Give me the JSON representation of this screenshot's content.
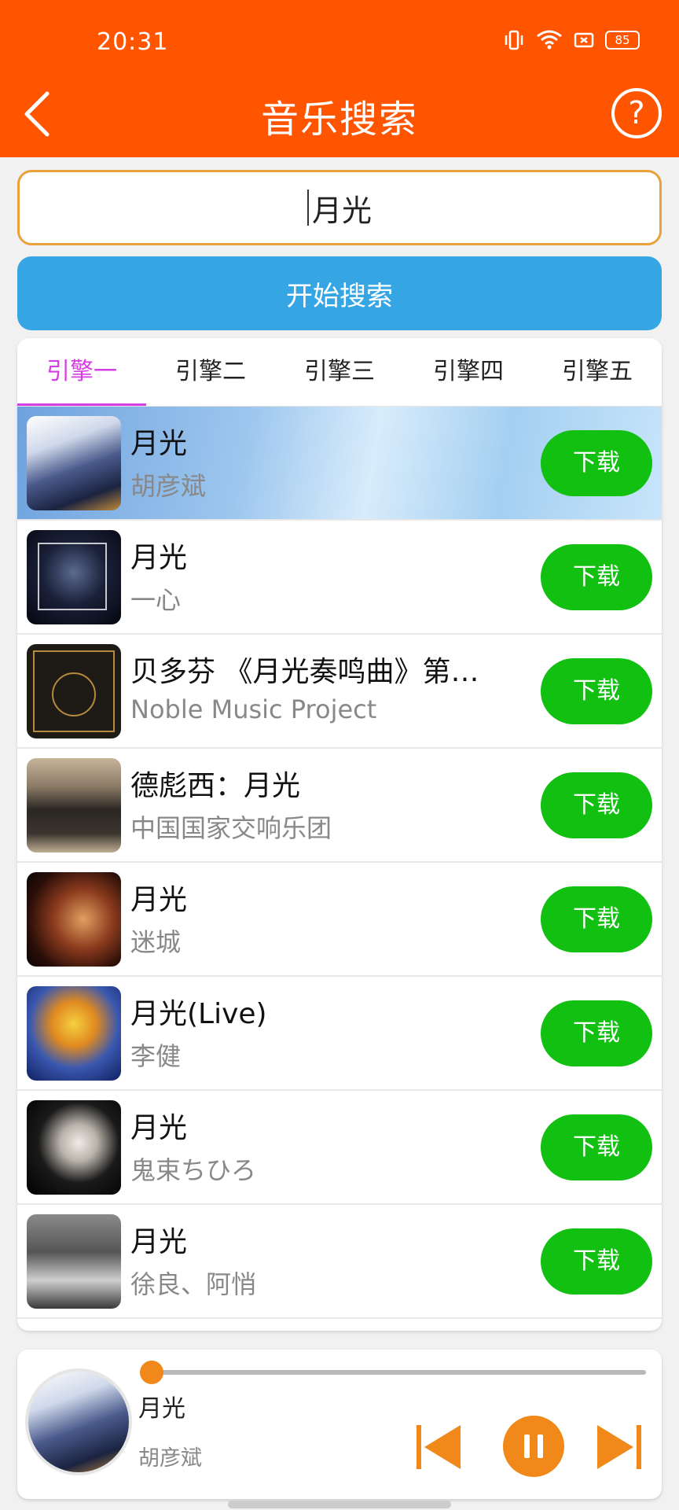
{
  "status": {
    "time": "20:31",
    "battery": "85"
  },
  "header": {
    "title": "音乐搜索"
  },
  "search": {
    "value": "月光",
    "button_label": "开始搜索"
  },
  "tabs": [
    "引擎一",
    "引擎二",
    "引擎三",
    "引擎四",
    "引擎五"
  ],
  "active_tab": "引擎一",
  "results": [
    {
      "title": "月光",
      "artist": "胡彦斌",
      "download": "下载"
    },
    {
      "title": "月光",
      "artist": "一心",
      "download": "下载"
    },
    {
      "title": "贝多芬 《月光奏鸣曲》第一...",
      "artist": "Noble Music Project",
      "download": "下载"
    },
    {
      "title": "德彪西：月光",
      "artist": "中国国家交响乐团",
      "download": "下载"
    },
    {
      "title": "月光",
      "artist": "迷城",
      "download": "下载"
    },
    {
      "title": "月光(Live)",
      "artist": "李健",
      "download": "下载"
    },
    {
      "title": "月光",
      "artist": "鬼束ちひろ",
      "download": "下载"
    },
    {
      "title": "月光",
      "artist": "徐良、阿悄",
      "download": "下载"
    }
  ],
  "player": {
    "title": "月光",
    "artist": "胡彦斌",
    "progress": 0.0
  },
  "colors": {
    "header": "#ff5500",
    "search_button": "#35a6e3",
    "download": "#11c011",
    "active_tab": "#d63de2",
    "player_accent": "#f0891a"
  },
  "icons": {
    "back": "back-arrow-icon",
    "help": "question-circle-icon",
    "prev": "skip-previous-icon",
    "pause": "pause-icon",
    "next": "skip-next-icon"
  }
}
